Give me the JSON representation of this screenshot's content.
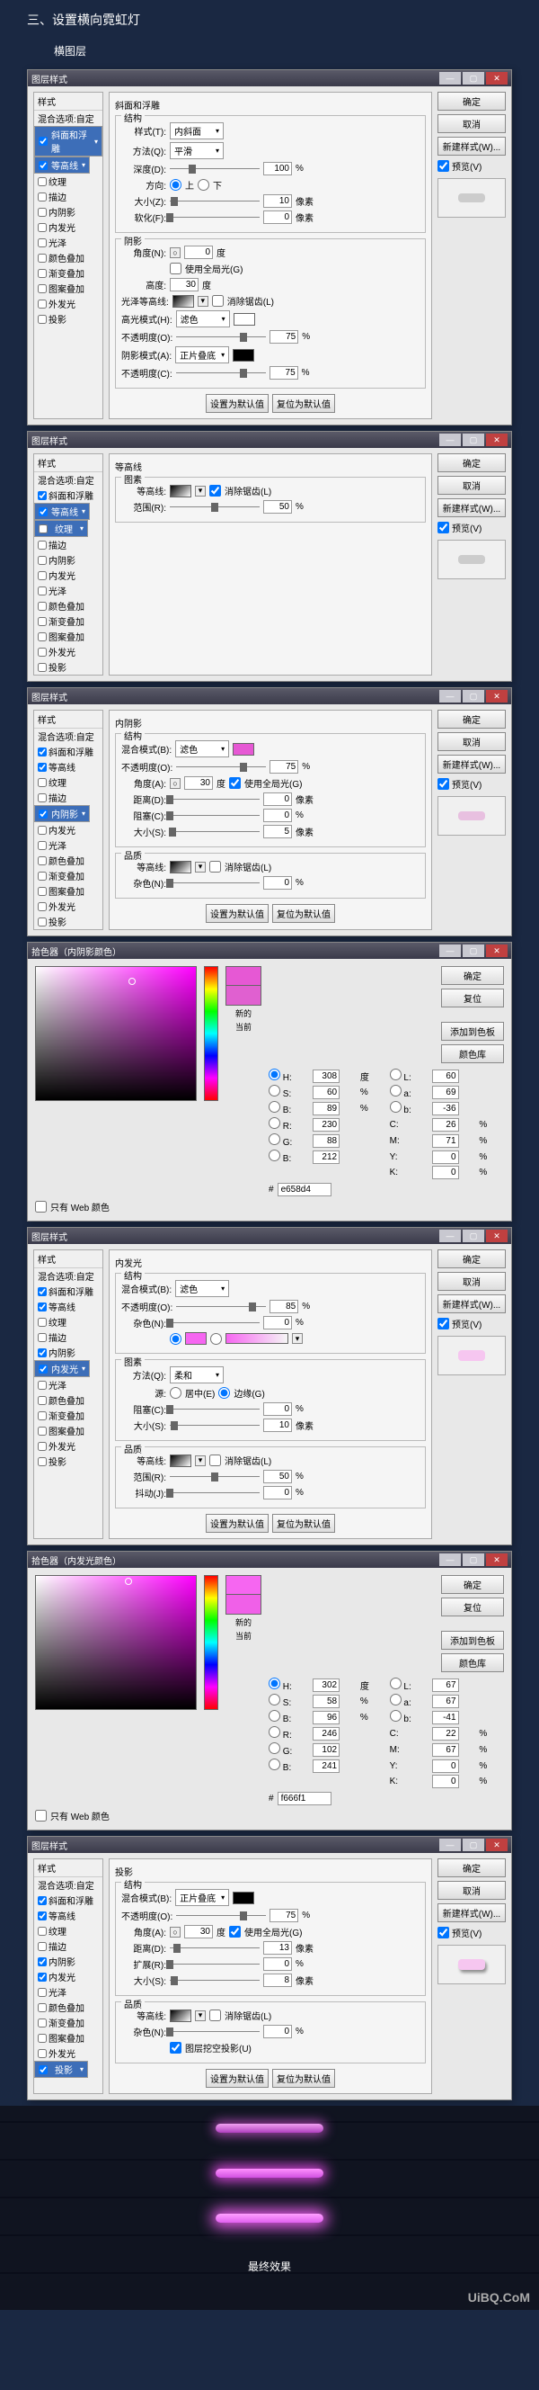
{
  "page_title": "三、设置横向霓虹灯",
  "subtitle": "横图层",
  "watermark": "UiBQ.CoM",
  "common": {
    "ok": "确定",
    "cancel": "取消",
    "new_style": "新建样式(W)...",
    "preview": "预览(V)",
    "set_default": "设置为默认值",
    "reset_default": "复位为默认值",
    "styles_header": "样式",
    "blend_options": "混合选项:自定",
    "window_title": "图层样式"
  },
  "style_names": {
    "bevel": "斜面和浮雕",
    "contour_s": "等高线",
    "texture": "纹理",
    "stroke": "描边",
    "inner_shadow": "内阴影",
    "inner_glow": "内发光",
    "satin": "光泽",
    "color_overlay": "颜色叠加",
    "grad_overlay": "渐变叠加",
    "pattern_overlay": "图案叠加",
    "outer_glow": "外发光",
    "drop_shadow": "投影"
  },
  "dlg1": {
    "panel_title": "斜面和浮雕",
    "sect_struct": "结构",
    "style_lbl": "样式(T):",
    "style_val": "内斜面",
    "method_lbl": "方法(Q):",
    "method_val": "平滑",
    "depth_lbl": "深度(D):",
    "depth_val": "100",
    "pct": "%",
    "dir_lbl": "方向:",
    "dir_up": "上",
    "dir_down": "下",
    "size_lbl": "大小(Z):",
    "size_val": "10",
    "px": "像素",
    "soften_lbl": "软化(F):",
    "soften_val": "0",
    "sect_shade": "阴影",
    "angle_lbl": "角度(N):",
    "angle_val": "0",
    "deg": "度",
    "global_lbl": "使用全局光(G)",
    "alt_lbl": "高度:",
    "alt_val": "30",
    "gloss_lbl": "光泽等高线:",
    "anti_lbl": "消除锯齿(L)",
    "hl_mode_lbl": "高光模式(H):",
    "hl_mode_val": "滤色",
    "hl_opacity_lbl": "不透明度(O):",
    "hl_opacity_val": "75",
    "sh_mode_lbl": "阴影模式(A):",
    "sh_mode_val": "正片叠底",
    "sh_opacity_lbl": "不透明度(C):",
    "sh_opacity_val": "75"
  },
  "dlg2": {
    "panel_title": "等高线",
    "sect": "图素",
    "contour_lbl": "等高线:",
    "anti_lbl": "消除锯齿(L)",
    "range_lbl": "范围(R):",
    "range_val": "50",
    "pct": "%"
  },
  "dlg3": {
    "panel_title": "内阴影",
    "sect_struct": "结构",
    "blend_lbl": "混合模式(B):",
    "blend_val": "滤色",
    "opacity_lbl": "不透明度(O):",
    "opacity_val": "75",
    "pct": "%",
    "angle_lbl": "角度(A):",
    "angle_val": "30",
    "deg": "度",
    "global_lbl": "使用全局光(G)",
    "dist_lbl": "距离(D):",
    "dist_val": "0",
    "px": "像素",
    "choke_lbl": "阻塞(C):",
    "choke_val": "0",
    "size_lbl": "大小(S):",
    "size_val": "5",
    "sect_qual": "品质",
    "contour_lbl": "等高线:",
    "anti_lbl": "消除锯齿(L)",
    "noise_lbl": "杂色(N):",
    "noise_val": "0",
    "color": "#e658d4"
  },
  "cp1": {
    "title": "拾色器（内阴影颜色）",
    "new_lbl": "新的",
    "cur_lbl": "当前",
    "ok": "确定",
    "cancel": "复位",
    "add": "添加到色板",
    "lib": "颜色库",
    "H": "308",
    "S": "60",
    "B": "89",
    "L": "60",
    "a": "69",
    "b2": "-36",
    "R": "230",
    "G": "88",
    "Bv": "212",
    "C": "26",
    "M": "71",
    "Y": "0",
    "K": "0",
    "hex": "e658d4",
    "web_only": "只有 Web 颜色",
    "deg": "度",
    "pct": "%"
  },
  "dlg4": {
    "panel_title": "内发光",
    "sect_struct": "结构",
    "blend_lbl": "混合模式(B):",
    "blend_val": "滤色",
    "opacity_lbl": "不透明度(O):",
    "opacity_val": "85",
    "pct": "%",
    "noise_lbl": "杂色(N):",
    "noise_val": "0",
    "sect_elem": "图素",
    "method_lbl": "方法(Q):",
    "method_val": "柔和",
    "source_lbl": "源:",
    "src_center": "居中(E)",
    "src_edge": "边缘(G)",
    "choke_lbl": "阻塞(C):",
    "choke_val": "0",
    "size_lbl": "大小(S):",
    "size_val": "10",
    "px": "像素",
    "sect_qual": "品质",
    "contour_lbl": "等高线:",
    "anti_lbl": "消除锯齿(L)",
    "range_lbl": "范围(R):",
    "range_val": "50",
    "jitter_lbl": "抖动(J):",
    "jitter_val": "0",
    "color": "#f666f1"
  },
  "cp2": {
    "title": "拾色器（内发光颜色）",
    "H": "302",
    "S": "58",
    "B": "96",
    "L": "67",
    "a": "67",
    "b2": "-41",
    "R": "246",
    "G": "102",
    "Bv": "241",
    "C": "22",
    "M": "67",
    "Y": "0",
    "K": "0",
    "hex": "f666f1"
  },
  "dlg5": {
    "panel_title": "投影",
    "sect_struct": "结构",
    "blend_lbl": "混合模式(B):",
    "blend_val": "正片叠底",
    "opacity_lbl": "不透明度(O):",
    "opacity_val": "75",
    "pct": "%",
    "angle_lbl": "角度(A):",
    "angle_val": "30",
    "deg": "度",
    "global_lbl": "使用全局光(G)",
    "dist_lbl": "距离(D):",
    "dist_val": "13",
    "px": "像素",
    "spread_lbl": "扩展(R):",
    "spread_val": "0",
    "size_lbl": "大小(S):",
    "size_val": "8",
    "sect_qual": "品质",
    "contour_lbl": "等高线:",
    "anti_lbl": "消除锯齿(L)",
    "noise_lbl": "杂色(N):",
    "noise_val": "0",
    "knockout_lbl": "图层挖空投影(U)"
  },
  "result_label": "最终效果",
  "neon": [
    {
      "shadow": "0 0 12px 3px rgba(255,100,255,.6)",
      "bg": "linear-gradient(#f0a0f0,#b040c0)"
    },
    {
      "shadow": "0 0 14px 4px rgba(255,80,255,.8)",
      "bg": "linear-gradient(#ff90ff,#d050e0)"
    },
    {
      "shadow": "0 0 16px 5px rgba(255,100,255,.9)",
      "bg": "linear-gradient(#ffa0ff,#e060f0)"
    }
  ]
}
